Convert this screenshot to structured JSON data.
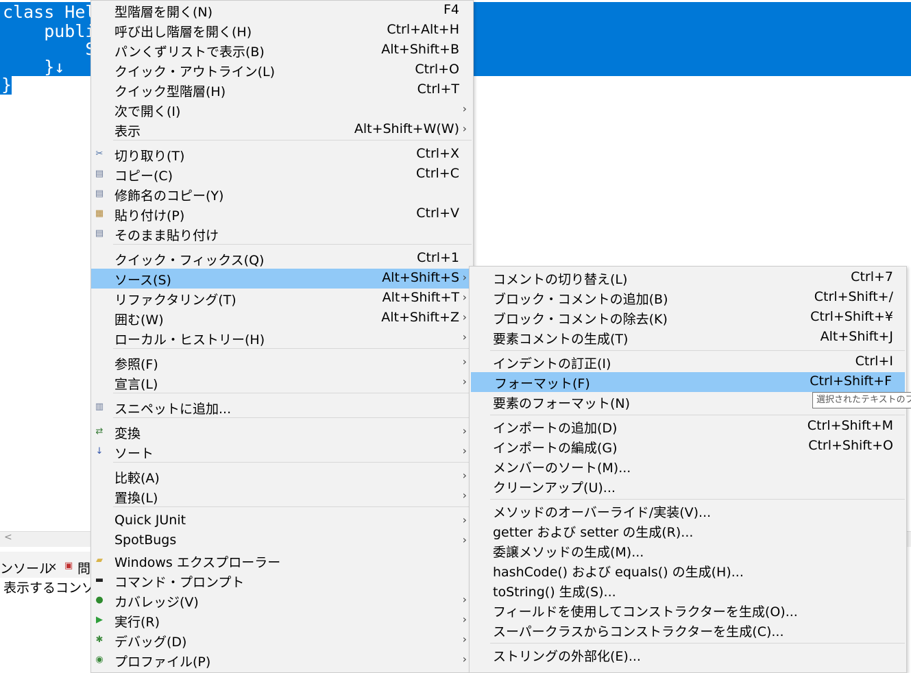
{
  "editor": {
    "code_lines": [
      "class Hel",
      "    publi",
      "        S",
      "    }↓",
      "}"
    ]
  },
  "bottom_panel": {
    "tab_console": "ンソール",
    "tab_console_close": "×",
    "tab_problems": "問",
    "content": "表示するコンソ"
  },
  "tooltip": "選択されたテキストのフォーマ",
  "main_menu": {
    "items": [
      {
        "label": "型階層を開く(N)",
        "shortcut": "F4"
      },
      {
        "label": "呼び出し階層を開く(H)",
        "shortcut": "Ctrl+Alt+H"
      },
      {
        "label": "パンくずリストで表示(B)",
        "shortcut": "Alt+Shift+B"
      },
      {
        "label": "クイック・アウトライン(L)",
        "shortcut": "Ctrl+O"
      },
      {
        "label": "クイック型階層(H)",
        "shortcut": "Ctrl+T"
      },
      {
        "label": "次で開く(I)",
        "shortcut": ""
      },
      {
        "label": "表示",
        "shortcut": "Alt+Shift+W(W)"
      },
      {
        "label": "切り取り(T)",
        "shortcut": "Ctrl+X",
        "icon": "scissors-icon"
      },
      {
        "label": "コピー(C)",
        "shortcut": "Ctrl+C",
        "icon": "copy-icon"
      },
      {
        "label": "修飾名のコピー(Y)",
        "shortcut": "",
        "icon": "copy-qualified-icon"
      },
      {
        "label": "貼り付け(P)",
        "shortcut": "Ctrl+V",
        "icon": "paste-icon"
      },
      {
        "label": "そのまま貼り付け",
        "shortcut": "",
        "icon": "paste-raw-icon"
      },
      {
        "label": "クイック・フィックス(Q)",
        "shortcut": "Ctrl+1"
      },
      {
        "label": "ソース(S)",
        "shortcut": "Alt+Shift+S"
      },
      {
        "label": "リファクタリング(T)",
        "shortcut": "Alt+Shift+T"
      },
      {
        "label": "囲む(W)",
        "shortcut": "Alt+Shift+Z"
      },
      {
        "label": "ローカル・ヒストリー(H)",
        "shortcut": ""
      },
      {
        "label": "参照(F)",
        "shortcut": ""
      },
      {
        "label": "宣言(L)",
        "shortcut": ""
      },
      {
        "label": "スニペットに追加...",
        "shortcut": "",
        "icon": "snippet-icon"
      },
      {
        "label": "変換",
        "shortcut": "",
        "icon": "convert-icon"
      },
      {
        "label": "ソート",
        "shortcut": "",
        "icon": "sort-icon"
      },
      {
        "label": "比較(A)",
        "shortcut": ""
      },
      {
        "label": "置換(L)",
        "shortcut": ""
      },
      {
        "label": "Quick JUnit",
        "shortcut": ""
      },
      {
        "label": "SpotBugs",
        "shortcut": ""
      },
      {
        "label": "Windows エクスプローラー",
        "shortcut": "",
        "icon": "folder-icon"
      },
      {
        "label": "コマンド・プロンプト",
        "shortcut": "",
        "icon": "terminal-icon"
      },
      {
        "label": "カバレッジ(V)",
        "shortcut": "",
        "icon": "coverage-icon"
      },
      {
        "label": "実行(R)",
        "shortcut": "",
        "icon": "run-icon"
      },
      {
        "label": "デバッグ(D)",
        "shortcut": "",
        "icon": "bug-icon"
      },
      {
        "label": "プロファイル(P)",
        "shortcut": "",
        "icon": "profile-icon"
      }
    ]
  },
  "sub_menu": {
    "items": [
      {
        "label": "コメントの切り替え(L)",
        "shortcut": "Ctrl+7"
      },
      {
        "label": "ブロック・コメントの追加(B)",
        "shortcut": "Ctrl+Shift+/"
      },
      {
        "label": "ブロック・コメントの除去(K)",
        "shortcut": "Ctrl+Shift+¥"
      },
      {
        "label": "要素コメントの生成(T)",
        "shortcut": "Alt+Shift+J"
      },
      {
        "label": "インデントの訂正(I)",
        "shortcut": "Ctrl+I"
      },
      {
        "label": "フォーマット(F)",
        "shortcut": "Ctrl+Shift+F"
      },
      {
        "label": "要素のフォーマット(N)",
        "shortcut": ""
      },
      {
        "label": "インポートの追加(D)",
        "shortcut": "Ctrl+Shift+M"
      },
      {
        "label": "インポートの編成(G)",
        "shortcut": "Ctrl+Shift+O"
      },
      {
        "label": "メンバーのソート(M)...",
        "shortcut": ""
      },
      {
        "label": "クリーンアップ(U)...",
        "shortcut": ""
      },
      {
        "label": "メソッドのオーバーライド/実装(V)...",
        "shortcut": ""
      },
      {
        "label": "getter および setter の生成(R)...",
        "shortcut": ""
      },
      {
        "label": "委譲メソッドの生成(M)...",
        "shortcut": ""
      },
      {
        "label": "hashCode() および equals() の生成(H)...",
        "shortcut": ""
      },
      {
        "label": "toString() 生成(S)...",
        "shortcut": ""
      },
      {
        "label": "フィールドを使用してコンストラクターを生成(O)...",
        "shortcut": ""
      },
      {
        "label": "スーパークラスからコンストラクターを生成(C)...",
        "shortcut": ""
      },
      {
        "label": "ストリングの外部化(E)...",
        "shortcut": ""
      }
    ]
  },
  "arrow_glyph": "›",
  "colors": {
    "selection": "#0078d7",
    "menu_highlight": "#91c9f7",
    "menu_bg": "#f2f2f2"
  }
}
